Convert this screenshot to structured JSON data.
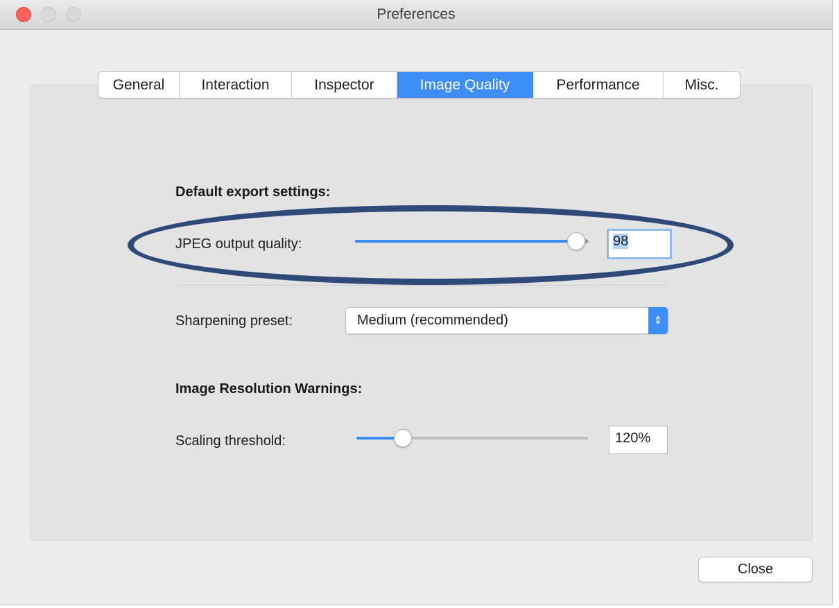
{
  "window": {
    "title": "Preferences"
  },
  "tabs": [
    {
      "label": "General",
      "active": false
    },
    {
      "label": "Interaction",
      "active": false
    },
    {
      "label": "Inspector",
      "active": false
    },
    {
      "label": "Image Quality",
      "active": true
    },
    {
      "label": "Performance",
      "active": false
    },
    {
      "label": "Misc."
    }
  ],
  "export_settings": {
    "heading": "Default export settings:",
    "jpeg_label": "JPEG output quality:",
    "jpeg_value": "98",
    "jpeg_slider_fraction": 0.98,
    "sharpening_label": "Sharpening preset:",
    "sharpening_value": "Medium (recommended)"
  },
  "resolution_warnings": {
    "heading": "Image Resolution Warnings:",
    "scaling_label": "Scaling threshold:",
    "scaling_value": "120%",
    "scaling_slider_fraction": 0.2
  },
  "footer": {
    "close_label": "Close"
  },
  "colors": {
    "accent": "#3d8ef7",
    "annotation": "#2f4a78",
    "close_light": "#fc615d"
  }
}
